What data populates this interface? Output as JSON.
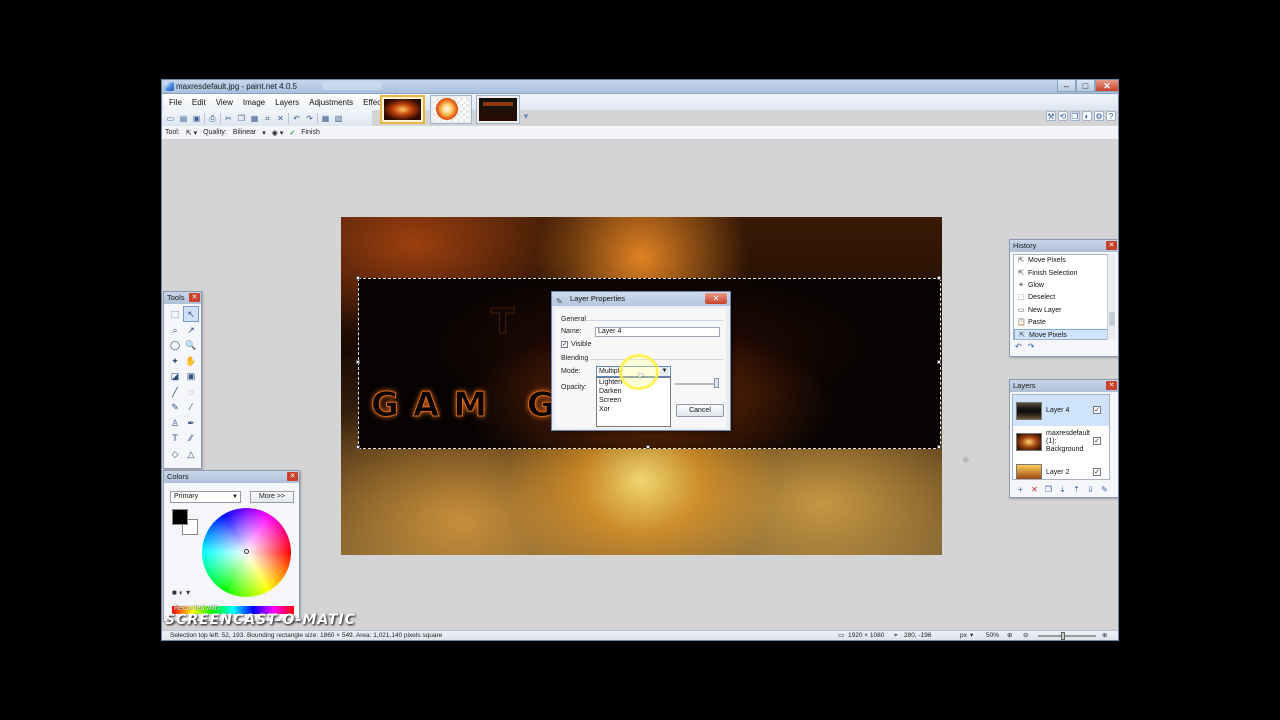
{
  "window": {
    "title": "maxresdefault.jpg - paint.net 4.0.5",
    "min_label": "–",
    "max_label": "□",
    "close_label": "✕"
  },
  "menu": [
    "File",
    "Edit",
    "View",
    "Image",
    "Layers",
    "Adjustments",
    "Effects"
  ],
  "toolbar_icons": [
    "new-icon",
    "open-icon",
    "save-icon",
    "print-icon",
    "cut-icon",
    "copy-icon",
    "paste-icon",
    "crop-icon",
    "deselect-icon",
    "undo-icon",
    "redo-icon",
    "grid-icon",
    "rulers-icon"
  ],
  "tool_options": {
    "tool_label": "Tool:",
    "quality_label": "Quality:",
    "quality_value": "Bilinear",
    "finish_label": "Finish"
  },
  "canvas": {
    "logo_top": "T   A",
    "logo_bottom": "GAM   GIRL"
  },
  "tools_panel": {
    "title": "Tools",
    "close": "✕",
    "tools": [
      "⬚",
      "↖",
      "⌕",
      "↗",
      "◯",
      "🔍",
      "✦",
      "✋",
      "◪",
      "▣",
      "╱",
      "◌",
      "✎",
      "⁄",
      "♙",
      "✒",
      "T",
      "⁄⁄",
      "◇",
      "△"
    ]
  },
  "colors_panel": {
    "title": "Colors",
    "close": "✕",
    "mode_value": "Primary",
    "more_button": "More >>",
    "recorded_text": "Recorded with"
  },
  "history_panel": {
    "title": "History",
    "close": "✕",
    "items": [
      {
        "icon": "move-pixels-icon",
        "glyph": "⇱",
        "label": "Move Pixels"
      },
      {
        "icon": "finish-selection-icon",
        "glyph": "⇱",
        "label": "Finish Selection"
      },
      {
        "icon": "glow-icon",
        "glyph": "☀",
        "label": "Glow"
      },
      {
        "icon": "deselect-icon",
        "glyph": "⬚",
        "label": "Deselect"
      },
      {
        "icon": "new-layer-icon",
        "glyph": "▭",
        "label": "New Layer"
      },
      {
        "icon": "paste-icon",
        "glyph": "📋",
        "label": "Paste"
      },
      {
        "icon": "move-pixels-icon",
        "glyph": "⇱",
        "label": "Move Pixels"
      }
    ],
    "undo_glyph": "↶",
    "redo_glyph": "↷"
  },
  "layers_panel": {
    "title": "Layers",
    "close": "✕",
    "layers": [
      {
        "name": "Layer 4",
        "checked": "✓"
      },
      {
        "name": "maxresdefault (1): Background",
        "checked": "✓"
      },
      {
        "name": "Layer 2",
        "checked": "✓"
      }
    ],
    "footer_glyphs": [
      "+",
      "✕",
      "❐",
      "⇣",
      "⇡",
      "⇩",
      "✎"
    ]
  },
  "layer_dialog": {
    "title": "Layer Properties",
    "close": "✕",
    "general_label": "General",
    "name_label": "Name:",
    "name_value": "Layer 4",
    "visible_label": "Visible",
    "visible_checked": "✓",
    "blending_label": "Blending",
    "mode_label": "Mode:",
    "mode_value": "Multiply",
    "opacity_label": "Opacity:",
    "mode_options": [
      "Lighten",
      "Darken",
      "Screen",
      "Xor"
    ],
    "cancel_label": "Cancel"
  },
  "status_bar": {
    "selection_info": "Selection top left: 52, 193. Bounding rectangle size: 1860 × 549. Area: 1,021,140 pixels square",
    "image_size": "1920 × 1080",
    "cursor_pos": "280, -196",
    "units": "px",
    "zoom": "50%"
  },
  "watermark": "SCREENCAST-O-MATIC"
}
